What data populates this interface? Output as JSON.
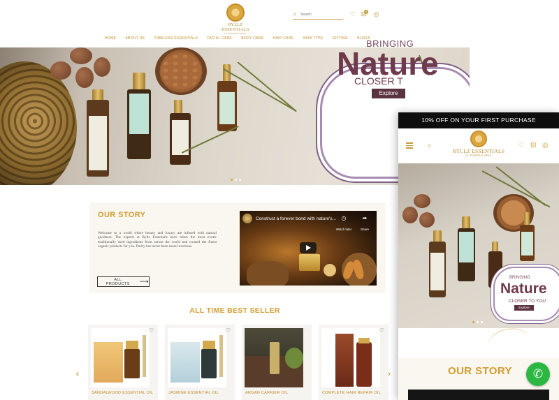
{
  "desktop": {
    "logo": {
      "name": "RYLLZ ESSENTIALS",
      "tagline": "LUXURIOUS SPAS"
    },
    "search": {
      "placeholder": "Search"
    },
    "cart": {
      "count": "0"
    },
    "nav": [
      "HOME",
      "ABOUT US",
      "TIMELESS ESSENTIALS",
      "FACIAL CARE",
      "BODY CARE",
      "HAIR CARE",
      "SKIN TYPE",
      "GIFTING",
      "BLOGS"
    ],
    "hero": {
      "line1": "BRINGING",
      "line2": "Nature",
      "line3": "CLOSER T",
      "button": "Explore"
    },
    "story": {
      "heading": "OUR STORY",
      "text": "Welcome to a world where beauty and luxury are infused with natural goodness. The experts at Ryllz Essentials have taken the most exotic traditionally used ingredients from across the world and created the finest organic products for you. Purity has never been more luxurious.",
      "button": "ALL PRODUCTS",
      "video": {
        "title": "Construct a forever bond with nature's...",
        "watch_later": "Watch later",
        "share": "Share"
      }
    },
    "best_seller": {
      "heading": "ALL TIME BEST SELLER",
      "products": [
        {
          "name": "SANDALWOOD ESSENTIAL OIL"
        },
        {
          "name": "JASMINE ESSENTIAL OIL"
        },
        {
          "name": "ARGAN CARRIER OIL"
        },
        {
          "name": "COMPLETE HAIR REPAIR OIL"
        }
      ]
    }
  },
  "mobile": {
    "promo": "10% OFF ON YOUR FIRST PURCHASE",
    "logo": {
      "name": "RYLLZ ESSENTIALS",
      "tagline": "LUXURIOUS SPAS"
    },
    "hero": {
      "line1": "BRINGING",
      "line2": "Nature",
      "line3": "CLOSER TO YOU",
      "button": "Explore"
    },
    "story_heading": "OUR STORY"
  },
  "icons": {
    "search": "search-icon",
    "wishlist": "heart-icon",
    "cart": "bag-icon",
    "account": "user-icon",
    "menu": "hamburger-icon",
    "prev": "chevron-left-icon",
    "next": "chevron-right-icon",
    "whatsapp": "whatsapp-icon"
  },
  "colors": {
    "gold": "#c59a3b",
    "plum": "#6e3a4c",
    "promo_bar": "#0e0e0e",
    "whatsapp": "#2bb741"
  }
}
